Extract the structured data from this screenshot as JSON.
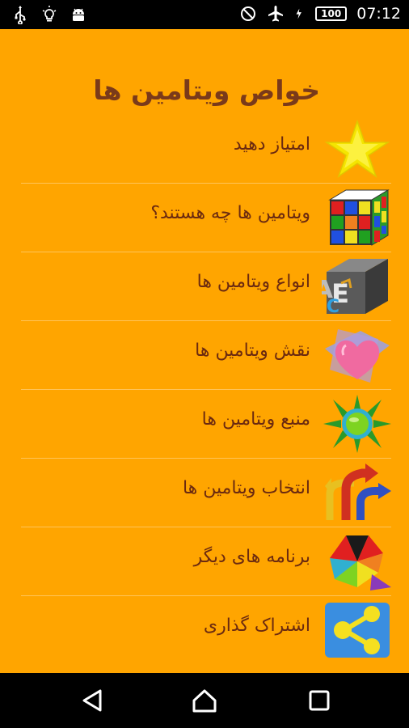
{
  "status_bar": {
    "battery": "100",
    "time": "07:12",
    "icons_left": [
      "usb-icon",
      "bulb-icon",
      "android-icon"
    ],
    "icons_right": [
      "do-not-disturb-icon",
      "airplane-icon",
      "battery-charging-icon"
    ]
  },
  "header": {
    "title": "خواص ویتامین ها"
  },
  "menu": {
    "items": [
      {
        "label": "امتیاز دهید",
        "icon": "star-icon"
      },
      {
        "label": "ویتامین ها چه هستند؟",
        "icon": "rubik-cube-icon"
      },
      {
        "label": "انواع ویتامین ها",
        "icon": "abc-blocks-icon"
      },
      {
        "label": "نقش ویتامین ها",
        "icon": "heart-icon"
      },
      {
        "label": "منبع ویتامین ها",
        "icon": "sun-icon"
      },
      {
        "label": "انتخاب ویتامین ها",
        "icon": "arrows-icon"
      },
      {
        "label": "برنامه های دیگر",
        "icon": "colorful-shapes-icon"
      },
      {
        "label": "اشتراک گذاری",
        "icon": "share-icon"
      }
    ]
  },
  "nav_bar": {
    "icons": [
      "back-icon",
      "home-icon",
      "recents-icon"
    ]
  },
  "colors": {
    "background": "#FFA500",
    "text": "#6b2a10",
    "title": "#7a3a1a"
  }
}
